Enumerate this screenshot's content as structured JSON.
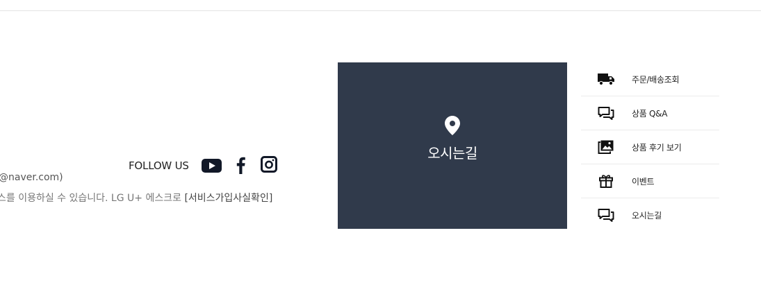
{
  "follow": {
    "label": "FOLLOW US",
    "links": [
      {
        "icon": "youtube-icon"
      },
      {
        "icon": "facebook-icon"
      },
      {
        "icon": "instagram-icon"
      }
    ]
  },
  "footer_info": {
    "email_fragment": "@naver.com)",
    "service_text": "스를 이용하실 수 있습니다. LG U+ 에스크로 ",
    "service_link": "[서비스가입사실확인]"
  },
  "map_tile": {
    "icon": "map-pin-icon",
    "label": "오시는길",
    "background": "#303a4b"
  },
  "quick_menu": {
    "items": [
      {
        "label": "주문/배송조회",
        "icon": "truck-icon"
      },
      {
        "label": "상품 Q&A",
        "icon": "chat-bubble-icon"
      },
      {
        "label": "상품 후기 보기",
        "icon": "image-icon"
      },
      {
        "label": "이벤트",
        "icon": "gift-icon"
      },
      {
        "label": "오시는길",
        "icon": "chat-bubble-icon"
      }
    ]
  }
}
